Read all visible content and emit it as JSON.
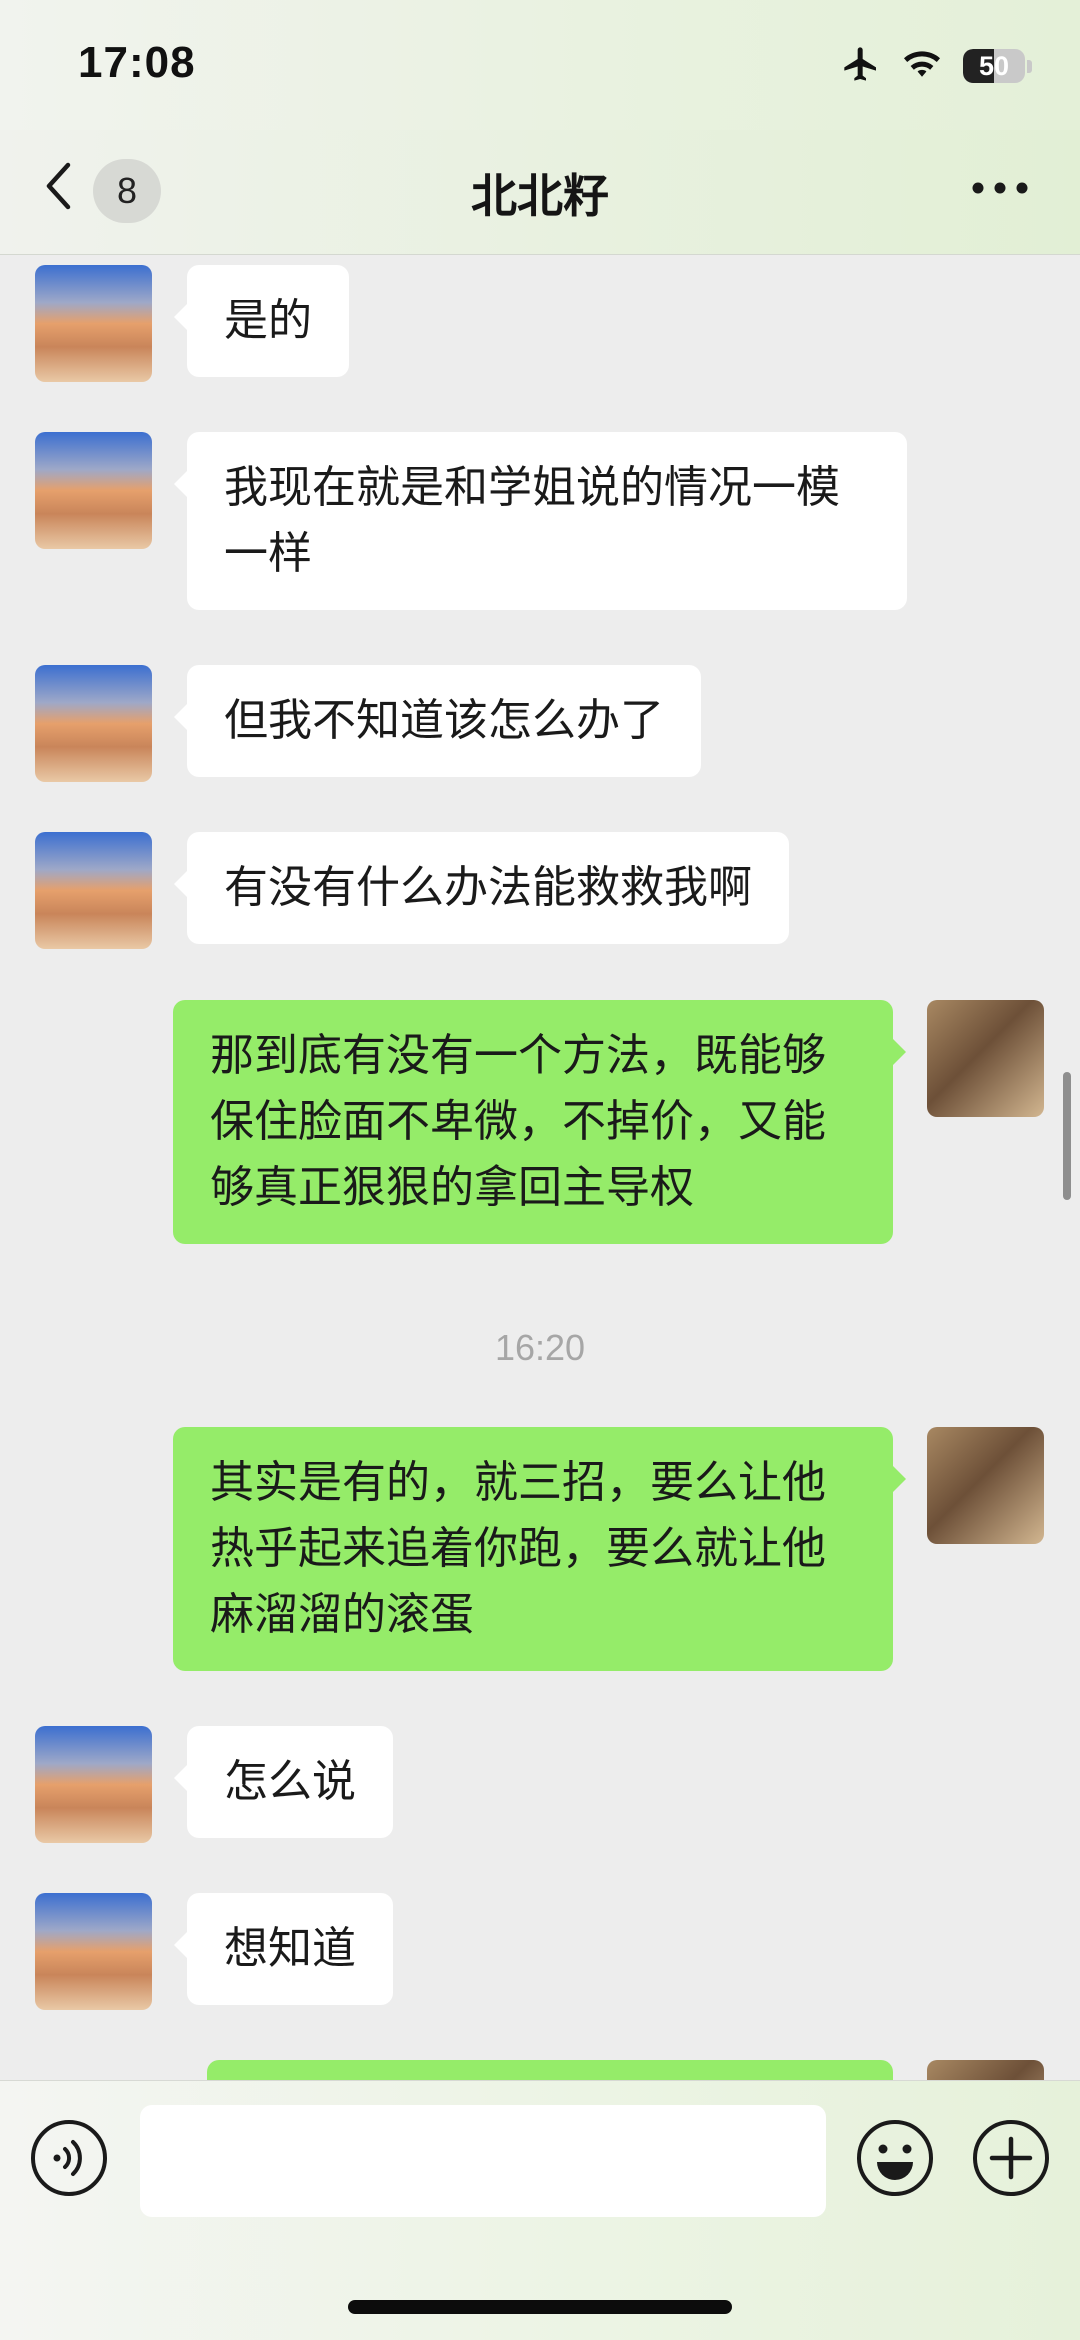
{
  "status_bar": {
    "time": "17:08",
    "battery_level": "50",
    "battery_fraction": 0.5,
    "icons": [
      "airplane-icon",
      "wifi-icon",
      "battery-icon"
    ]
  },
  "nav": {
    "back_icon": "chevron-left-icon",
    "unread_count": "8",
    "title": "北北籽",
    "more_icon": "ellipsis-icon"
  },
  "messages": [
    {
      "from": "other",
      "text": "是的"
    },
    {
      "from": "other",
      "text": "我现在就是和学姐说的情况一模一样"
    },
    {
      "from": "other",
      "text": "但我不知道该怎么办了"
    },
    {
      "from": "other",
      "text": "有没有什么办法能救救我啊"
    },
    {
      "from": "self",
      "text": "那到底有没有一个方法，既能够保住脸面不卑微，不掉价，又能够真正狠狠的拿回主导权"
    },
    {
      "type": "timestamp",
      "text": "16:20"
    },
    {
      "from": "self",
      "text": "其实是有的，就三招，要么让他热乎起来追着你跑，要么就让他麻溜溜的滚蛋"
    },
    {
      "from": "other",
      "text": "怎么说"
    },
    {
      "from": "other",
      "text": "想知道"
    },
    {
      "from": "self",
      "text": ""
    }
  ],
  "input_bar": {
    "voice_icon": "voice-icon",
    "input_value": "",
    "emoji_icon": "emoji-icon",
    "plus_icon": "plus-icon"
  },
  "colors": {
    "self_bubble": "#95ec69",
    "other_bubble": "#ffffff",
    "chat_background": "#ededed"
  }
}
